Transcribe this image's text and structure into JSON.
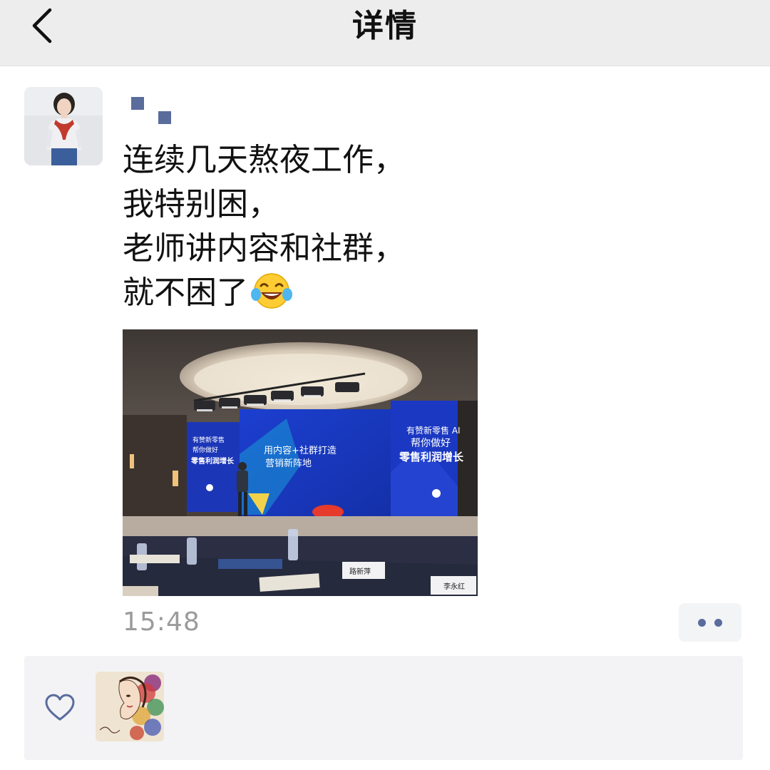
{
  "navbar": {
    "title": "详情",
    "back_icon": "chevron-left-icon"
  },
  "post": {
    "text_lines": [
      "连续几天熬夜工作，",
      "我特别困，",
      "老师讲内容和社群，",
      "就不困了"
    ],
    "emoji": "laughing-tears-emoji",
    "image": {
      "screen_left_lines": [
        "有赞新零售",
        "帮你做好",
        "零售利润增长"
      ],
      "screen_center_lines": [
        "用内容+社群打造",
        "营销新阵地"
      ],
      "screen_right_lines": [
        "有赞新零售 AI",
        "帮你做好",
        "零售利润增长"
      ],
      "nameplate_1": "路新萍",
      "nameplate_2": "李永红"
    },
    "timestamp": "15:48",
    "more_icon": "more-dots-icon"
  },
  "likes": {
    "icon": "heart-icon"
  },
  "colors": {
    "navbar_bg": "#ededed",
    "link_blue": "#5a6c9c",
    "timestamp_gray": "#9b9b9b",
    "likes_bg": "#f3f3f5"
  }
}
